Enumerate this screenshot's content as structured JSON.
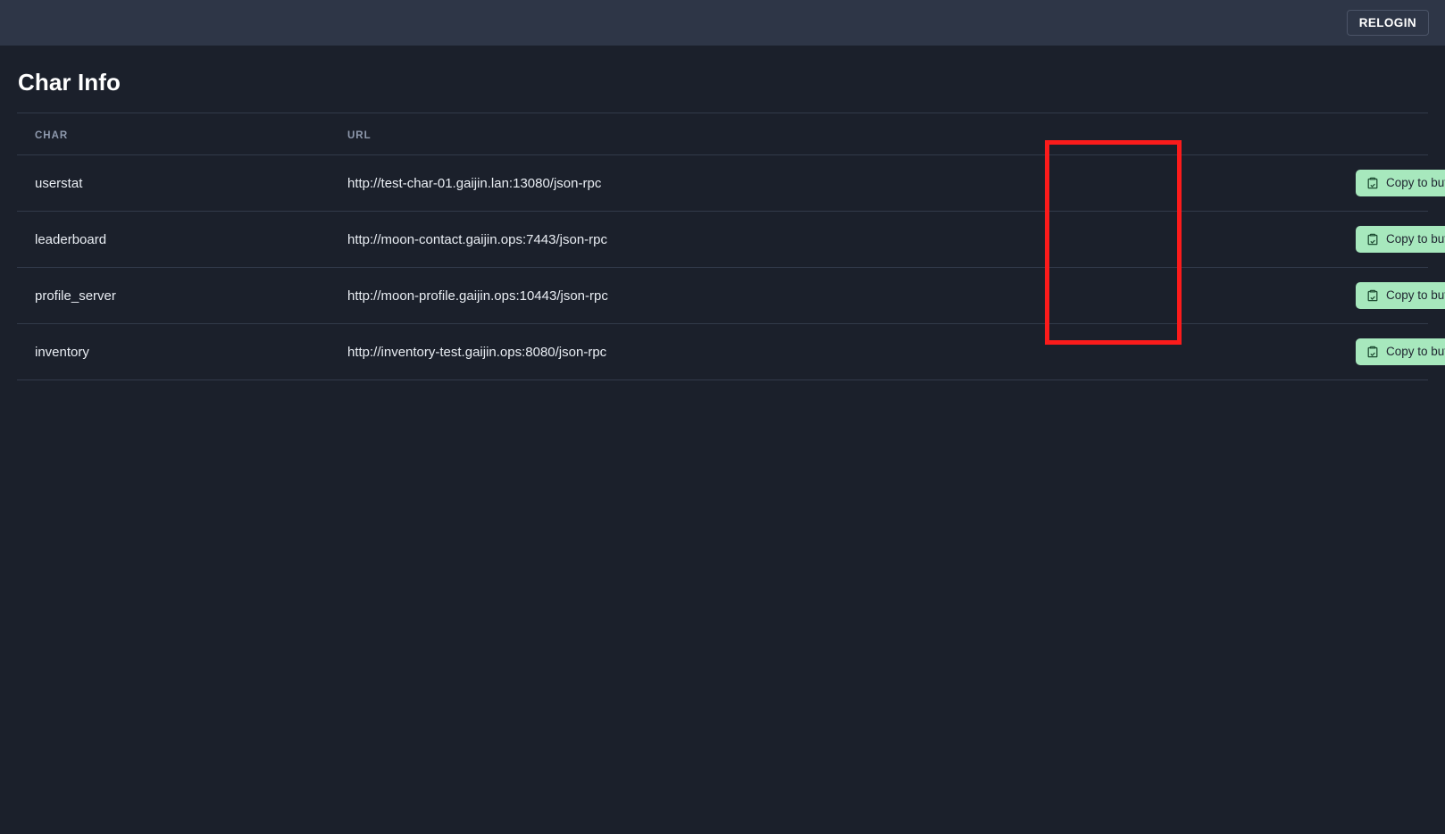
{
  "navbar": {
    "relogin_label": "RELOGIN"
  },
  "page": {
    "title": "Char Info"
  },
  "table": {
    "headers": {
      "char": "CHAR",
      "url": "URL",
      "action": ""
    },
    "rows": [
      {
        "char": "userstat",
        "url": "http://test-char-01.gaijin.lan:13080/json-rpc",
        "copy_label": "Copy to buffer",
        "copy_icon": "clipboard-check-icon"
      },
      {
        "char": "leaderboard",
        "url": "http://moon-contact.gaijin.ops:7443/json-rpc",
        "copy_label": "Copy to buffer",
        "copy_icon": "clipboard-check-icon"
      },
      {
        "char": "profile_server",
        "url": "http://moon-profile.gaijin.ops:10443/json-rpc",
        "copy_label": "Copy to buffer",
        "copy_icon": "clipboard-check-icon"
      },
      {
        "char": "inventory",
        "url": "http://inventory-test.gaijin.ops:8080/json-rpc",
        "copy_label": "Copy to buffer",
        "copy_icon": "clipboard-check-icon"
      }
    ]
  },
  "colors": {
    "navbar_bg": "#2e3647",
    "page_bg": "#1b202b",
    "divider": "#323a4a",
    "text_primary": "#e9edf3",
    "text_muted": "#8e99ad",
    "button_bg": "#a7e8bd",
    "button_text": "#1f2430",
    "annotation": "#fb1b1b"
  },
  "annotation": {
    "shape": "rectangle",
    "target": "copy-to-buffer-button-column"
  }
}
